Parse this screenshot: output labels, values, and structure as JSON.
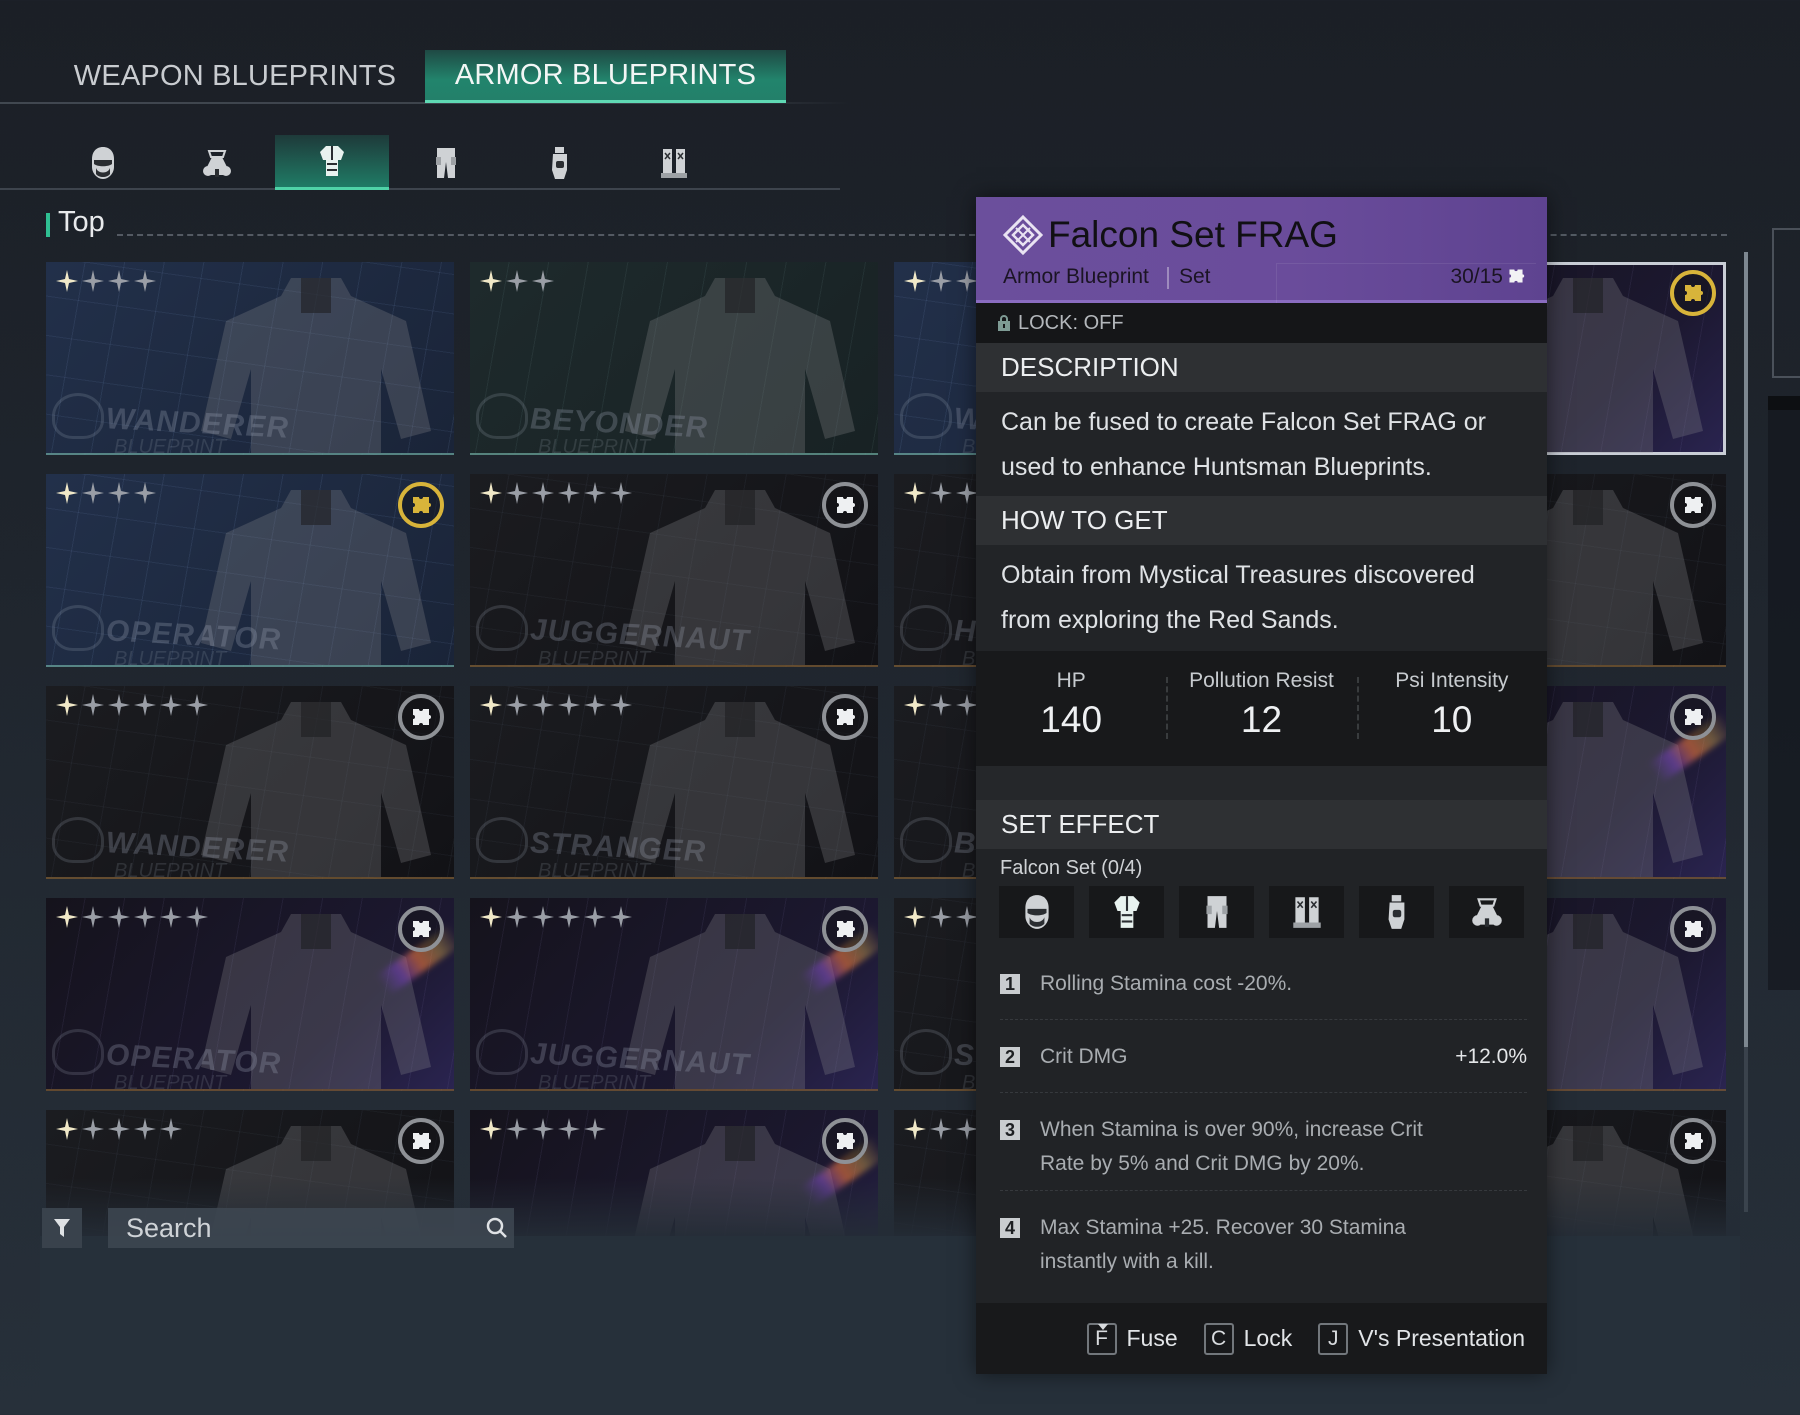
{
  "main_tabs": [
    {
      "label": "WEAPON BLUEPRINTS",
      "active": false
    },
    {
      "label": "ARMOR BLUEPRINTS",
      "active": true
    }
  ],
  "sub_tabs": [
    {
      "icon": "helmet-icon",
      "label": "Helmet",
      "active": false
    },
    {
      "icon": "gas-mask-icon",
      "label": "Mask",
      "active": false
    },
    {
      "icon": "top-armor-icon",
      "label": "Top",
      "active": true
    },
    {
      "icon": "pants-icon",
      "label": "Bottoms",
      "active": false
    },
    {
      "icon": "glove-icon",
      "label": "Gloves",
      "active": false
    },
    {
      "icon": "boots-icon",
      "label": "Boots",
      "active": false
    }
  ],
  "section": {
    "title": "Top"
  },
  "colors": {
    "accent_teal": "#23806a",
    "header_purple": "#6b4f9c",
    "badge_gold": "#d8b43a",
    "badge_gray": "#8e9196"
  },
  "grid": {
    "cards": [
      {
        "brand": "WANDERER",
        "stars": 4,
        "badge": null,
        "bg": "blue"
      },
      {
        "brand": "BEYONDER",
        "stars": 3,
        "badge": null,
        "bg": "green"
      },
      {
        "brand": "WANDERER",
        "stars": 3,
        "badge": null,
        "bg": "blue"
      },
      {
        "brand": "",
        "stars": 0,
        "badge": "gold",
        "bg": "purple",
        "selected": true
      },
      {
        "brand": "OPERATOR",
        "stars": 4,
        "badge": "gold",
        "bg": "blue"
      },
      {
        "brand": "JUGGERNAUT",
        "stars": 6,
        "badge": "gray",
        "bg": "dark"
      },
      {
        "brand": "HUNTSMAN",
        "stars": 3,
        "badge": null,
        "bg": "dark"
      },
      {
        "brand": "",
        "stars": 0,
        "badge": "gray",
        "bg": "dark"
      },
      {
        "brand": "WANDERER",
        "stars": 6,
        "badge": "gray",
        "bg": "dark"
      },
      {
        "brand": "STRANGER",
        "stars": 6,
        "badge": "gray",
        "bg": "dark"
      },
      {
        "brand": "BEYONDER",
        "stars": 3,
        "badge": null,
        "bg": "dark"
      },
      {
        "brand": "",
        "stars": 0,
        "badge": "gray",
        "bg": "purple",
        "rainbow": true
      },
      {
        "brand": "OPERATOR",
        "stars": 6,
        "badge": "gray",
        "bg": "purple",
        "rainbow": true
      },
      {
        "brand": "JUGGERNAUT",
        "stars": 6,
        "badge": "gray",
        "bg": "purple",
        "rainbow": true
      },
      {
        "brand": "STRANGER",
        "stars": 3,
        "badge": null,
        "bg": "dark"
      },
      {
        "brand": "",
        "stars": 0,
        "badge": "gray",
        "bg": "purple"
      },
      {
        "brand": "",
        "stars": 5,
        "badge": "gray",
        "bg": "dark"
      },
      {
        "brand": "",
        "stars": 5,
        "badge": "gray",
        "bg": "purple",
        "rainbow": true
      },
      {
        "brand": "",
        "stars": 3,
        "badge": null,
        "bg": "dark"
      },
      {
        "brand": "",
        "stars": 0,
        "badge": "gray",
        "bg": "dark"
      }
    ],
    "brand_sub": "BLUEPRINT"
  },
  "search": {
    "placeholder": "Search",
    "value": ""
  },
  "detail": {
    "title": "Falcon Set FRAG",
    "type": "Armor Blueprint",
    "subtype": "Set",
    "count": "30/15",
    "lock": "LOCK: OFF",
    "description_heading": "DESCRIPTION",
    "description": "Can be fused to create Falcon Set FRAG or used to enhance Huntsman Blueprints.",
    "how_heading": "HOW TO GET",
    "how_to_get": "Obtain from Mystical Treasures discovered from exploring the Red Sands.",
    "stats": [
      {
        "label": "HP",
        "value": "140"
      },
      {
        "label": "Pollution Resist",
        "value": "12"
      },
      {
        "label": "Psi Intensity",
        "value": "10"
      }
    ],
    "set_heading": "SET EFFECT",
    "set_name": "Falcon Set (0/4)",
    "set_pieces": [
      "helmet-icon",
      "top-armor-icon",
      "pants-icon",
      "boots-icon",
      "glove-icon",
      "gas-mask-icon"
    ],
    "effects": [
      {
        "n": "1",
        "text": "Rolling Stamina cost -20%.",
        "value": ""
      },
      {
        "n": "2",
        "text": "Crit DMG",
        "value": "+12.0%"
      },
      {
        "n": "3",
        "text": "When Stamina is over 90%, increase Crit Rate by 5% and Crit DMG by 20%.",
        "value": ""
      },
      {
        "n": "4",
        "text": "Max Stamina +25. Recover 30 Stamina instantly with a kill.",
        "value": ""
      }
    ],
    "hotkeys": [
      {
        "key": "F",
        "label": "Fuse"
      },
      {
        "key": "C",
        "label": "Lock"
      },
      {
        "key": "J",
        "label": "V's Presentation"
      }
    ]
  }
}
